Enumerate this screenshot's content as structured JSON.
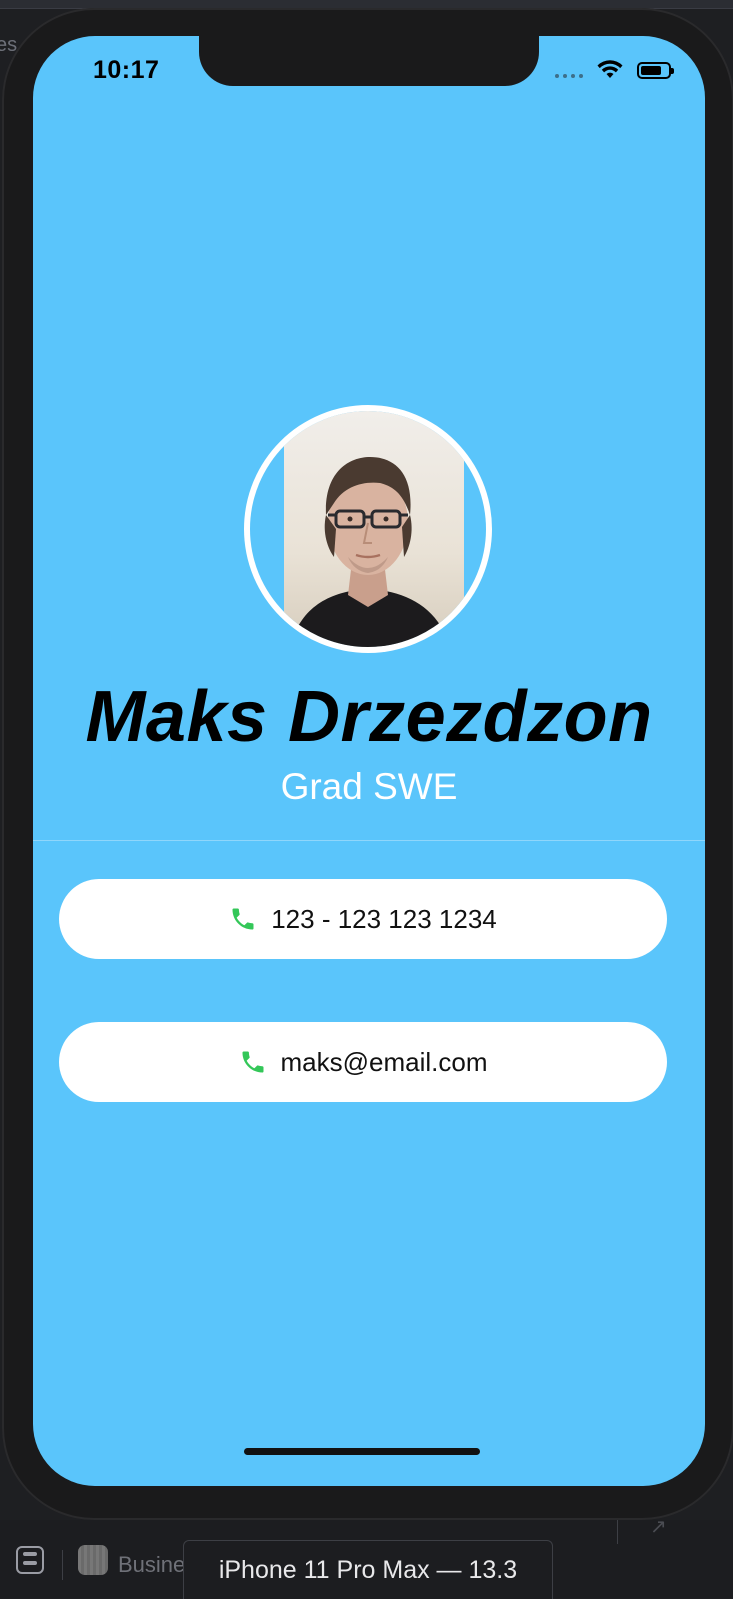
{
  "status_bar": {
    "time": "10:17"
  },
  "profile": {
    "name": "Maks Drzezdzon",
    "title": "Grad SWE"
  },
  "contacts": [
    {
      "icon": "phone-icon",
      "label": "123 - 123 123 1234"
    },
    {
      "icon": "phone-icon",
      "label": "maks@email.com"
    }
  ],
  "colors": {
    "screen_background": "#5ac5fb",
    "pill_background": "#ffffff",
    "icon_green": "#34c759",
    "subtitle": "#ffffff"
  },
  "taskbar": {
    "app_label": "Busine",
    "simulator_label": "iPhone 11 Pro Max — 13.3"
  },
  "edge_text": "es"
}
